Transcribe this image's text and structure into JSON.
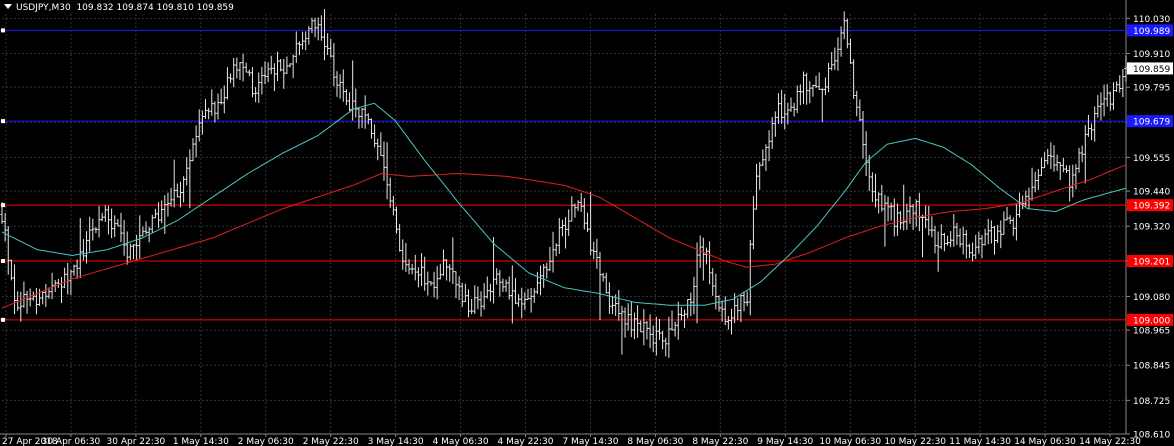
{
  "header": {
    "symbol_tf": "USDJPY,M30",
    "ohlc": "109.832 109.874 109.810 109.859"
  },
  "colors": {
    "background": "#000000",
    "grid": "#343434",
    "bars": "#e8e8e8",
    "ma_fast": "#4fc3c3",
    "ma_slow": "#e02020",
    "level_blue": "#1a1aff",
    "level_red": "#ff0000",
    "axis_text": "#ffffff"
  },
  "chart_data": {
    "type": "ohlc",
    "ylim": [
      108.61,
      110.045
    ],
    "y_ticks": [
      "110.030",
      "109.910",
      "109.795",
      "109.675",
      "109.555",
      "109.440",
      "109.320",
      "109.201",
      "109.080",
      "108.965",
      "108.845",
      "108.725",
      "108.610"
    ],
    "x_ticks": [
      "27 Apr 2018",
      "30 Apr 06:30",
      "30 Apr 22:30",
      "1 May 14:30",
      "2 May 06:30",
      "2 May 22:30",
      "3 May 14:30",
      "4 May 06:30",
      "4 May 22:30",
      "7 May 14:30",
      "8 May 06:30",
      "8 May 22:30",
      "9 May 14:30",
      "10 May 06:30",
      "10 May 22:30",
      "11 May 14:30",
      "14 May 06:30",
      "14 May 22:30"
    ],
    "current_price": "109.859",
    "levels": [
      {
        "price": 109.989,
        "label": "109.989",
        "color": "blue"
      },
      {
        "price": 109.679,
        "label": "109.679",
        "color": "blue"
      },
      {
        "price": 109.392,
        "label": "109.392",
        "color": "red"
      },
      {
        "price": 109.201,
        "label": "109.201",
        "color": "red"
      },
      {
        "price": 109.0,
        "label": "109.000",
        "color": "red"
      }
    ],
    "close_path": [
      [
        0,
        109.36
      ],
      [
        2,
        109.05
      ],
      [
        5,
        109.08
      ],
      [
        8,
        109.12
      ],
      [
        10,
        109.18
      ],
      [
        12,
        109.25
      ],
      [
        14,
        109.38
      ],
      [
        16,
        109.33
      ],
      [
        18,
        109.22
      ],
      [
        20,
        109.28
      ],
      [
        23,
        109.38
      ],
      [
        26,
        109.48
      ],
      [
        28,
        109.66
      ],
      [
        30,
        109.72
      ],
      [
        32,
        109.8
      ],
      [
        34,
        109.9
      ],
      [
        36,
        109.78
      ],
      [
        38,
        109.84
      ],
      [
        41,
        109.88
      ],
      [
        43,
        109.96
      ],
      [
        45,
        110.02
      ],
      [
        47,
        109.86
      ],
      [
        48.5,
        109.76
      ],
      [
        50,
        109.72
      ],
      [
        52,
        109.68
      ],
      [
        54,
        109.55
      ],
      [
        56,
        109.32
      ],
      [
        57,
        109.22
      ],
      [
        59,
        109.18
      ],
      [
        61,
        109.12
      ],
      [
        63,
        109.2
      ],
      [
        65,
        109.1
      ],
      [
        67,
        109.04
      ],
      [
        69,
        109.1
      ],
      [
        71,
        109.15
      ],
      [
        73,
        109.08
      ],
      [
        74,
        109.06
      ],
      [
        76,
        109.12
      ],
      [
        78,
        109.22
      ],
      [
        80,
        109.32
      ],
      [
        82,
        109.4
      ],
      [
        84,
        109.25
      ],
      [
        86,
        109.1
      ],
      [
        88,
        109.0
      ],
      [
        90,
        108.98
      ],
      [
        92,
        108.96
      ],
      [
        94,
        108.92
      ],
      [
        96,
        109.02
      ],
      [
        98,
        109.06
      ],
      [
        99,
        109.22
      ],
      [
        100,
        109.25
      ],
      [
        101,
        109.12
      ],
      [
        102,
        109.02
      ],
      [
        104,
        109.0
      ],
      [
        105,
        109.08
      ],
      [
        106,
        109.05
      ],
      [
        107,
        109.4
      ],
      [
        108,
        109.55
      ],
      [
        109,
        109.62
      ],
      [
        110,
        109.72
      ],
      [
        112,
        109.7
      ],
      [
        113,
        109.76
      ],
      [
        114,
        109.82
      ],
      [
        116,
        109.78
      ],
      [
        118,
        109.85
      ],
      [
        119,
        109.94
      ],
      [
        120,
        110.02
      ],
      [
        121,
        109.82
      ],
      [
        122,
        109.68
      ],
      [
        123,
        109.56
      ],
      [
        124,
        109.45
      ],
      [
        126,
        109.38
      ],
      [
        128,
        109.32
      ],
      [
        130,
        109.4
      ],
      [
        132,
        109.3
      ],
      [
        134,
        109.26
      ],
      [
        136,
        109.3
      ],
      [
        138,
        109.24
      ],
      [
        140,
        109.28
      ],
      [
        142,
        109.3
      ],
      [
        144,
        109.34
      ],
      [
        146,
        109.42
      ],
      [
        148,
        109.52
      ],
      [
        150,
        109.55
      ],
      [
        151,
        109.5
      ],
      [
        152,
        109.48
      ],
      [
        154,
        109.6
      ],
      [
        156,
        109.72
      ],
      [
        158,
        109.76
      ],
      [
        159,
        109.79
      ],
      [
        160,
        109.86
      ]
    ],
    "ma_fast_path": [
      [
        0,
        109.3
      ],
      [
        5,
        109.24
      ],
      [
        10,
        109.22
      ],
      [
        15,
        109.24
      ],
      [
        20,
        109.28
      ],
      [
        25,
        109.34
      ],
      [
        30,
        109.42
      ],
      [
        35,
        109.5
      ],
      [
        40,
        109.57
      ],
      [
        45,
        109.63
      ],
      [
        50,
        109.72
      ],
      [
        53,
        109.74
      ],
      [
        56,
        109.68
      ],
      [
        60,
        109.55
      ],
      [
        65,
        109.4
      ],
      [
        70,
        109.26
      ],
      [
        75,
        109.16
      ],
      [
        80,
        109.11
      ],
      [
        85,
        109.09
      ],
      [
        90,
        109.06
      ],
      [
        95,
        109.05
      ],
      [
        100,
        109.05
      ],
      [
        104,
        109.07
      ],
      [
        108,
        109.13
      ],
      [
        112,
        109.22
      ],
      [
        116,
        109.32
      ],
      [
        120,
        109.44
      ],
      [
        123,
        109.54
      ],
      [
        126,
        109.6
      ],
      [
        130,
        109.62
      ],
      [
        134,
        109.59
      ],
      [
        138,
        109.53
      ],
      [
        142,
        109.45
      ],
      [
        146,
        109.38
      ],
      [
        150,
        109.37
      ],
      [
        154,
        109.41
      ],
      [
        160,
        109.45
      ]
    ],
    "ma_slow_path": [
      [
        0,
        109.04
      ],
      [
        10,
        109.14
      ],
      [
        20,
        109.21
      ],
      [
        30,
        109.28
      ],
      [
        40,
        109.38
      ],
      [
        45,
        109.42
      ],
      [
        50,
        109.46
      ],
      [
        54,
        109.5
      ],
      [
        58,
        109.49
      ],
      [
        65,
        109.5
      ],
      [
        72,
        109.49
      ],
      [
        80,
        109.46
      ],
      [
        85,
        109.42
      ],
      [
        90,
        109.35
      ],
      [
        95,
        109.28
      ],
      [
        100,
        109.23
      ],
      [
        103,
        109.2
      ],
      [
        106,
        109.18
      ],
      [
        110,
        109.19
      ],
      [
        115,
        109.23
      ],
      [
        120,
        109.28
      ],
      [
        125,
        109.32
      ],
      [
        130,
        109.35
      ],
      [
        135,
        109.37
      ],
      [
        140,
        109.38
      ],
      [
        145,
        109.4
      ],
      [
        150,
        109.44
      ],
      [
        155,
        109.48
      ],
      [
        160,
        109.53
      ]
    ]
  }
}
